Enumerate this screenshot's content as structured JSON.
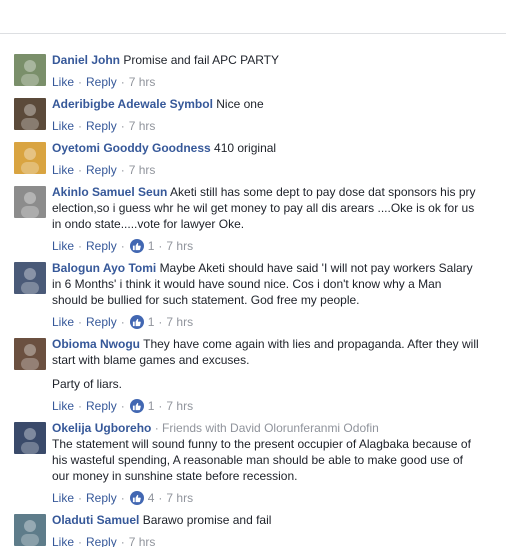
{
  "comments": [
    {
      "author": "Daniel John",
      "sub": "",
      "lines": [
        "Promise and fail APC PARTY"
      ],
      "extra": "",
      "like": "Like",
      "reply": "Reply",
      "likes": "",
      "time": "7 hrs"
    },
    {
      "author": "Aderibigbe Adewale Symbol",
      "sub": "",
      "lines": [
        "Nice one"
      ],
      "extra": "",
      "like": "Like",
      "reply": "Reply",
      "likes": "",
      "time": "7 hrs"
    },
    {
      "author": "Oyetomi Gooddy Goodness",
      "sub": "",
      "lines": [
        "410 original"
      ],
      "extra": "",
      "like": "Like",
      "reply": "Reply",
      "likes": "",
      "time": "7 hrs"
    },
    {
      "author": "Akinlo Samuel Seun",
      "sub": "",
      "lines": [
        "Aketi still has some dept to pay dose dat sponsors his pry",
        "election,so i guess whr he wil get money to pay all dis arears ....Oke is ok for us",
        "in ondo state.....vote for lawyer Oke."
      ],
      "extra": "",
      "like": "Like",
      "reply": "Reply",
      "likes": "1",
      "time": "7 hrs"
    },
    {
      "author": "Balogun Ayo Tomi",
      "sub": "",
      "lines": [
        "Maybe Aketi should have said 'I will not pay workers Salary",
        "in 6 Months' i think it would have sound nice. Cos i don't know why a Man",
        "should be bullied for such statement. God free my people."
      ],
      "extra": "",
      "like": "Like",
      "reply": "Reply",
      "likes": "1",
      "time": "7 hrs"
    },
    {
      "author": "Obioma Nwogu",
      "sub": "",
      "lines": [
        "They have come again with lies and propaganda. After they will",
        "start with blame games and excuses."
      ],
      "extra": "Party of liars.",
      "like": "Like",
      "reply": "Reply",
      "likes": "1",
      "time": "7 hrs"
    },
    {
      "author": "Okelija Ugboreho",
      "sub": "· Friends with David Olorunferanmi Odofin",
      "lines": [
        "The statement will sound funny to the present occupier of Alagbaka because of",
        "his wasteful spending, A reasonable man should be able to make good use of",
        "our money in sunshine state before recession."
      ],
      "extra": "",
      "like": "Like",
      "reply": "Reply",
      "likes": "4",
      "time": "7 hrs"
    },
    {
      "author": "Oladuti Samuel",
      "sub": "",
      "lines": [
        "Barawo promise and fail"
      ],
      "extra": "",
      "like": "Like",
      "reply": "Reply",
      "likes": "",
      "time": "7 hrs"
    }
  ],
  "avatar_colors": [
    "#7a8f6a",
    "#5b4a3a",
    "#d9a441",
    "#8c8c8c",
    "#4a5a78",
    "#6b5040",
    "#3a4a6a",
    "#5e7c8a"
  ],
  "accent": "#365899",
  "like_badge_color": "#4267b2"
}
